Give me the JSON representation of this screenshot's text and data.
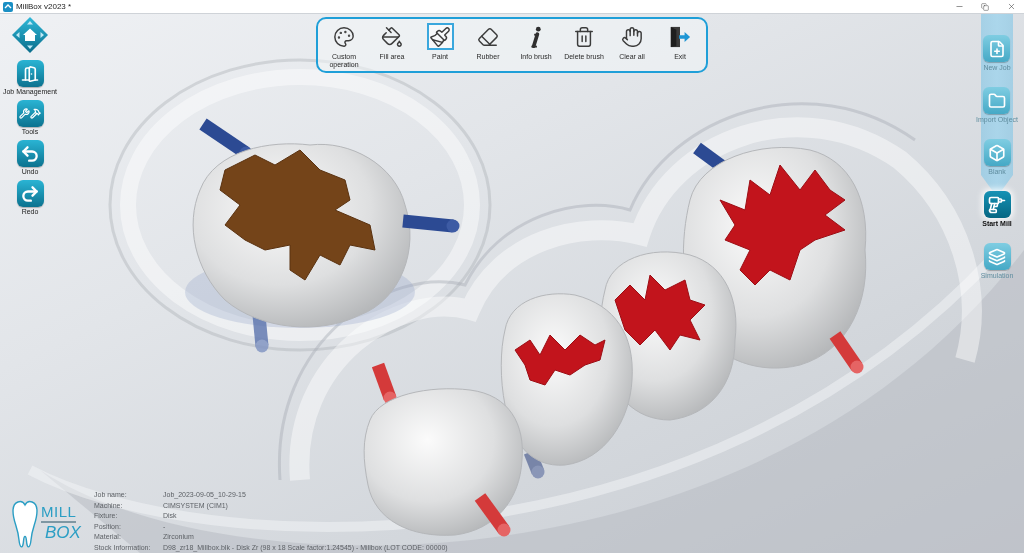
{
  "window": {
    "title": "MillBox v2023 *"
  },
  "left_toolbar": [
    {
      "kind": "home"
    },
    {
      "kind": "job_management",
      "label": "Job Management"
    },
    {
      "kind": "tools",
      "label": "Tools"
    },
    {
      "kind": "undo",
      "label": "Undo"
    },
    {
      "kind": "redo",
      "label": "Redo"
    }
  ],
  "top_toolbar": [
    {
      "kind": "custom",
      "label": "Custom operation",
      "selected": false
    },
    {
      "kind": "fill",
      "label": "Fill area",
      "selected": false
    },
    {
      "kind": "paint",
      "label": "Paint",
      "selected": true
    },
    {
      "kind": "rubber",
      "label": "Rubber",
      "selected": false
    },
    {
      "kind": "info",
      "label": "Info brush",
      "selected": false
    },
    {
      "kind": "delete",
      "label": "Delete brush",
      "selected": false
    },
    {
      "kind": "clear",
      "label": "Clear all",
      "selected": false
    },
    {
      "kind": "exit",
      "label": "Exit",
      "selected": false
    }
  ],
  "right_toolbar": [
    {
      "kind": "new_job",
      "label": "New Job",
      "selected": false
    },
    {
      "kind": "import",
      "label": "Import Object",
      "selected": false
    },
    {
      "kind": "blank",
      "label": "Blank",
      "selected": false
    },
    {
      "kind": "start_mill",
      "label": "Start Mill",
      "selected": true
    },
    {
      "kind": "simulation",
      "label": "Simulation",
      "selected": false
    }
  ],
  "logo": {
    "line_1": "MILL",
    "line_2": "BOX"
  },
  "job_info": [
    {
      "label": "Job name:",
      "value": "Job_2023-09-05_10-29-15"
    },
    {
      "label": "Machine:",
      "value": "CIMSYSTEM (CIM1)"
    },
    {
      "label": "Fixture:",
      "value": "Disk"
    },
    {
      "label": "Position:",
      "value": "-"
    },
    {
      "label": "Material:",
      "value": "Zirconium"
    },
    {
      "label": "Stock Information:",
      "value": "D98_zr18_Millbox.blk - Disk Zr (98 x 18 Scale factor:1.24545) - Millbox (LOT CODE: 00000)"
    }
  ]
}
